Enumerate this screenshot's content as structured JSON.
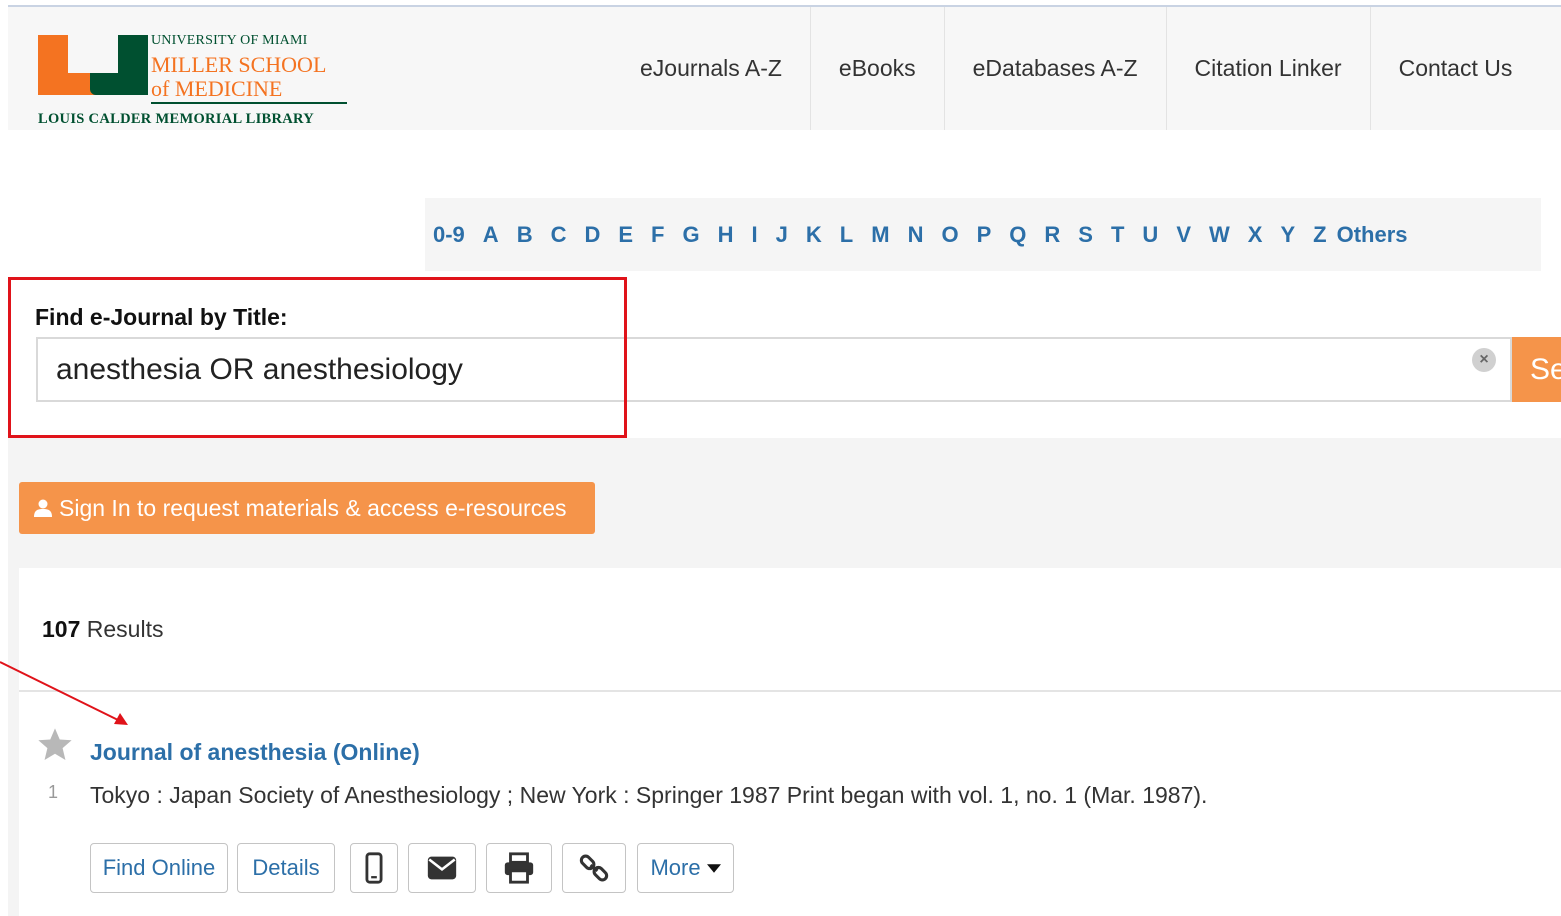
{
  "logo": {
    "line1": "UNIVERSITY OF MIAMI",
    "line2": "MILLER SCHOOL",
    "line3": "of MEDICINE",
    "line4": "LOUIS CALDER MEMORIAL LIBRARY"
  },
  "nav": {
    "items": [
      {
        "label": "eJournals A-Z"
      },
      {
        "label": "eBooks"
      },
      {
        "label": "eDatabases A-Z"
      },
      {
        "label": "Citation Linker"
      },
      {
        "label": "Contact Us"
      }
    ]
  },
  "alphabet": [
    "0-9",
    "A",
    "B",
    "C",
    "D",
    "E",
    "F",
    "G",
    "H",
    "I",
    "J",
    "K",
    "L",
    "M",
    "N",
    "O",
    "P",
    "Q",
    "R",
    "S",
    "T",
    "U",
    "V",
    "W",
    "X",
    "Y",
    "Z",
    "Others"
  ],
  "search": {
    "label": "Find e-Journal by Title:",
    "value": "anesthesia OR anesthesiology",
    "button_label": "Se"
  },
  "signin": {
    "label": "Sign In to request materials & access e-resources"
  },
  "results": {
    "count": "107",
    "count_label": " Results",
    "items": [
      {
        "number": "1",
        "title": "Journal of anesthesia (Online)",
        "description": "Tokyo : Japan Society of Anesthesiology ; New York : Springer 1987 Print began with vol. 1, no. 1 (Mar. 1987).",
        "actions": {
          "find_online": "Find Online",
          "details": "Details",
          "more": "More"
        }
      }
    ]
  },
  "colors": {
    "accent_orange": "#f5944a",
    "link_blue": "#2c6fa8",
    "highlight_red": "#e0131a",
    "brand_green": "#005030",
    "brand_orange": "#f47321"
  }
}
